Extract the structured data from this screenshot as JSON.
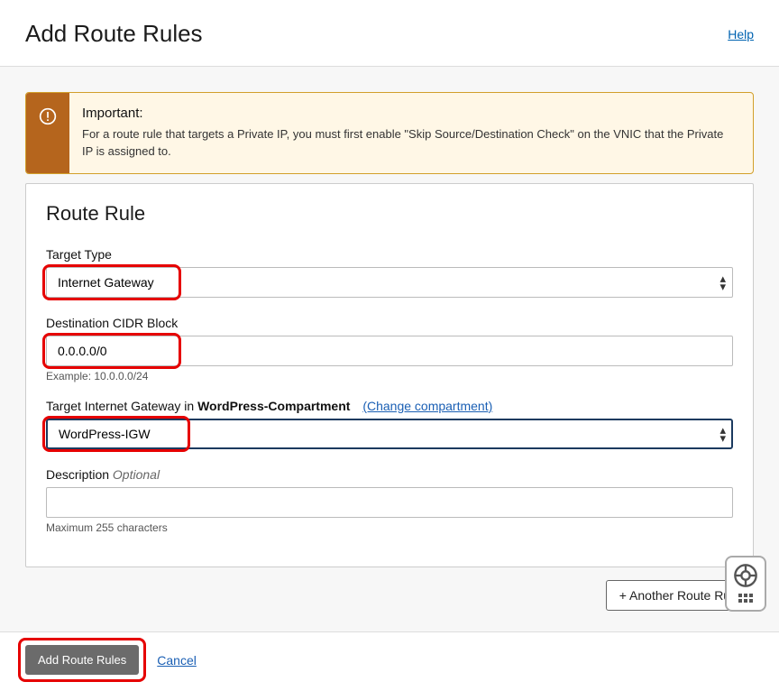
{
  "header": {
    "title": "Add Route Rules",
    "help": "Help"
  },
  "important": {
    "title": "Important:",
    "text": "For a route rule that targets a Private IP, you must first enable \"Skip Source/Destination Check\" on the VNIC that the Private IP is assigned to."
  },
  "panel": {
    "heading": "Route Rule",
    "target_type_label": "Target Type",
    "target_type_value": "Internet Gateway",
    "cidr_label": "Destination CIDR Block",
    "cidr_value": "0.0.0.0/0",
    "cidr_hint": "Example: 10.0.0.0/24",
    "target_gateway_label_prefix": "Target Internet Gateway in ",
    "target_gateway_compartment": "WordPress-Compartment",
    "change_compartment": "(Change compartment)",
    "target_gateway_value": "WordPress-IGW",
    "description_label": "Description",
    "description_optional": "Optional",
    "description_value": "",
    "description_hint": "Maximum 255 characters"
  },
  "another_rule": "+ Another Route Rule",
  "footer": {
    "submit": "Add Route Rules",
    "cancel": "Cancel"
  }
}
